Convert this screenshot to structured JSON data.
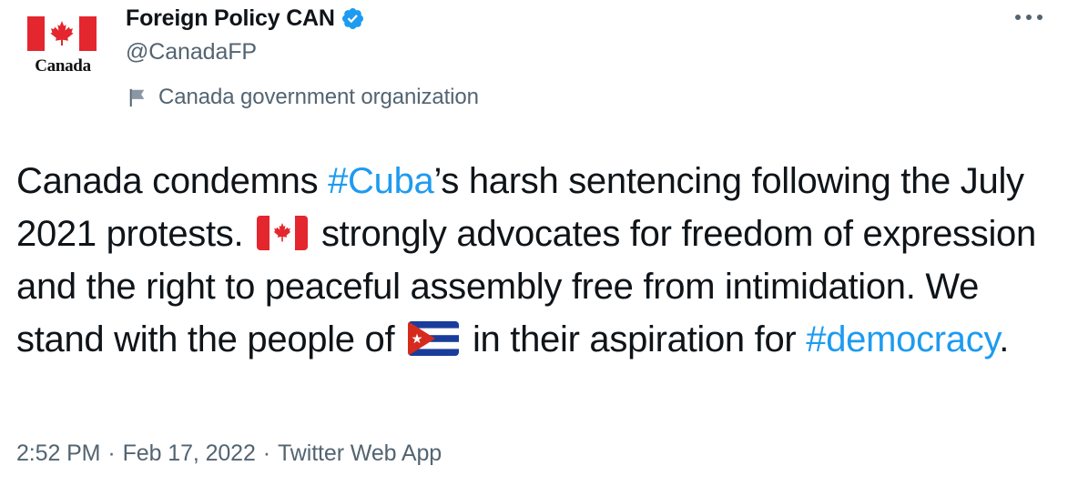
{
  "author": {
    "display_name": "Foreign Policy CAN",
    "handle": "@CanadaFP",
    "avatar_wordmark": "Canada",
    "label": "Canada government organization",
    "verified": true
  },
  "tweet": {
    "part1": "Canada condemns ",
    "hashtag1": "#Cuba",
    "part2": "’s harsh sentencing following the July 2021 protests. ",
    "part3": " strongly advocates for freedom of expression and the right to peaceful assembly free from intimidation. We stand with the people of ",
    "part4": " in their aspiration for ",
    "hashtag2": "#democracy",
    "part5": "."
  },
  "meta": {
    "time": "2:52 PM",
    "separator": "·",
    "date": "Feb 17, 2022",
    "source": "Twitter Web App"
  },
  "colors": {
    "link": "#1d9bf0",
    "secondary_text": "#536471",
    "primary_text": "#0f1419",
    "canada_red": "#e4262e",
    "cuba_blue": "#1a3d9c",
    "cuba_red": "#d52b1e"
  },
  "icons": {
    "verified": "verified-badge-icon",
    "label_flag": "flag-icon",
    "more": "more-options-icon"
  }
}
